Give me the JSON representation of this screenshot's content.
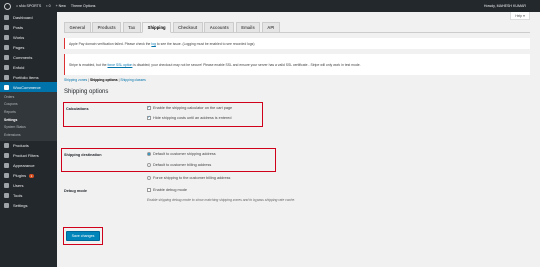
{
  "adminbar": {
    "site_name": "sNo SPORTS",
    "comments_count": "0",
    "new_label": "New",
    "theme_options": "Theme Options",
    "howdy": "Howdy, MAHESH KUMAR"
  },
  "help_label": "Help ▾",
  "sidebar": {
    "items_top": [
      {
        "label": "Dashboard",
        "icon": "dashboard-icon"
      },
      {
        "label": "Posts",
        "icon": "pin-icon"
      },
      {
        "label": "Works",
        "icon": "portfolio-icon"
      },
      {
        "label": "Pages",
        "icon": "page-icon"
      },
      {
        "label": "Comments",
        "icon": "comment-icon"
      },
      {
        "label": "Enfold",
        "icon": "enfold-icon"
      },
      {
        "label": "Portfolio Items",
        "icon": "portfolio-items-icon"
      },
      {
        "label": "WooCommerce",
        "icon": "woocommerce-icon"
      }
    ],
    "submenu": [
      "Orders",
      "Coupons",
      "Reports",
      "Settings",
      "System Status",
      "Extensions"
    ],
    "items_bottom": [
      {
        "label": "Products",
        "icon": "products-icon"
      },
      {
        "label": "Product Filters",
        "icon": "filter-icon"
      },
      {
        "label": "Appearance",
        "icon": "brush-icon"
      },
      {
        "label": "Plugins",
        "icon": "plugin-icon",
        "badge": "1"
      },
      {
        "label": "Users",
        "icon": "users-icon"
      },
      {
        "label": "Tools",
        "icon": "wrench-icon"
      },
      {
        "label": "Settings",
        "icon": "settings-icon"
      }
    ]
  },
  "tabs": [
    "General",
    "Products",
    "Tax",
    "Shipping",
    "Checkout",
    "Accounts",
    "Emails",
    "API"
  ],
  "notice1": {
    "before": "Apple Pay domain verification failed. Please check the ",
    "link": "log",
    "after": " to see the issue. (Logging must be enabled to see recorded logs)"
  },
  "notice2": {
    "before": "Stripe is enabled, but the ",
    "link": "force SSL option",
    "after": " is disabled; your checkout may not be secure! Please enable SSL and ensure your server has a valid SSL certificate - Stripe will only work in test mode."
  },
  "subsub": {
    "zones": "Shipping zones",
    "options": "Shipping options",
    "classes": "Shipping classes",
    "sep": " | "
  },
  "heading": "Shipping options",
  "calculations": {
    "label": "Calculations",
    "opt1": "Enable the shipping calculator on the cart page",
    "opt2": "Hide shipping costs until an address is entered"
  },
  "destination": {
    "label": "Shipping destination",
    "opt1": "Default to customer shipping address",
    "opt2": "Default to customer billing address",
    "opt3": "Force shipping to the customer billing address"
  },
  "debug": {
    "label": "Debug mode",
    "opt": "Enable debug mode",
    "desc": "Enable shipping debug mode to show matching shipping zones and to bypass shipping rate cache."
  },
  "save_label": "Save changes",
  "colors": {
    "highlight": "#d0021b",
    "primary": "#0085ba",
    "sidebar": "#23282d",
    "active_menu": "#0073aa"
  }
}
